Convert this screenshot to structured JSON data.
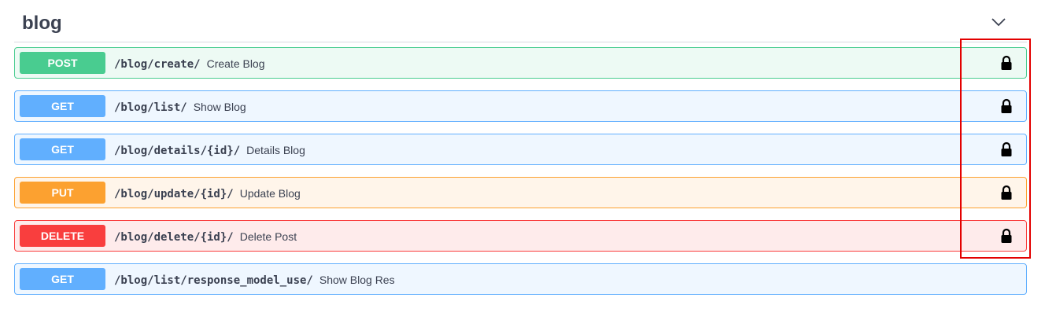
{
  "section": {
    "title": "blog",
    "toggle_icon": "chevron-down-icon"
  },
  "operations": [
    {
      "method": "POST",
      "path": "/blog/create/",
      "summary": "Create Blog",
      "locked": true,
      "method_color": "#49cc90",
      "bg_color": "#edfaf4",
      "border_color": "#49cc90"
    },
    {
      "method": "GET",
      "path": "/blog/list/",
      "summary": "Show Blog",
      "locked": true,
      "method_color": "#61affe",
      "bg_color": "#eff7ff",
      "border_color": "#61affe"
    },
    {
      "method": "GET",
      "path": "/blog/details/{id}/",
      "summary": "Details Blog",
      "locked": true,
      "method_color": "#61affe",
      "bg_color": "#eff7ff",
      "border_color": "#61affe"
    },
    {
      "method": "PUT",
      "path": "/blog/update/{id}/",
      "summary": "Update Blog",
      "locked": true,
      "method_color": "#fca130",
      "bg_color": "#fff5ea",
      "border_color": "#fca130"
    },
    {
      "method": "DELETE",
      "path": "/blog/delete/{id}/",
      "summary": "Delete Post",
      "locked": true,
      "method_color": "#f93e3e",
      "bg_color": "#feebeb",
      "border_color": "#f93e3e"
    },
    {
      "method": "GET",
      "path": "/blog/list/response_model_use/",
      "summary": "Show Blog Res",
      "locked": false,
      "method_color": "#61affe",
      "bg_color": "#eff7ff",
      "border_color": "#61affe"
    }
  ],
  "annotation": {
    "highlight_color": "#e30000"
  }
}
